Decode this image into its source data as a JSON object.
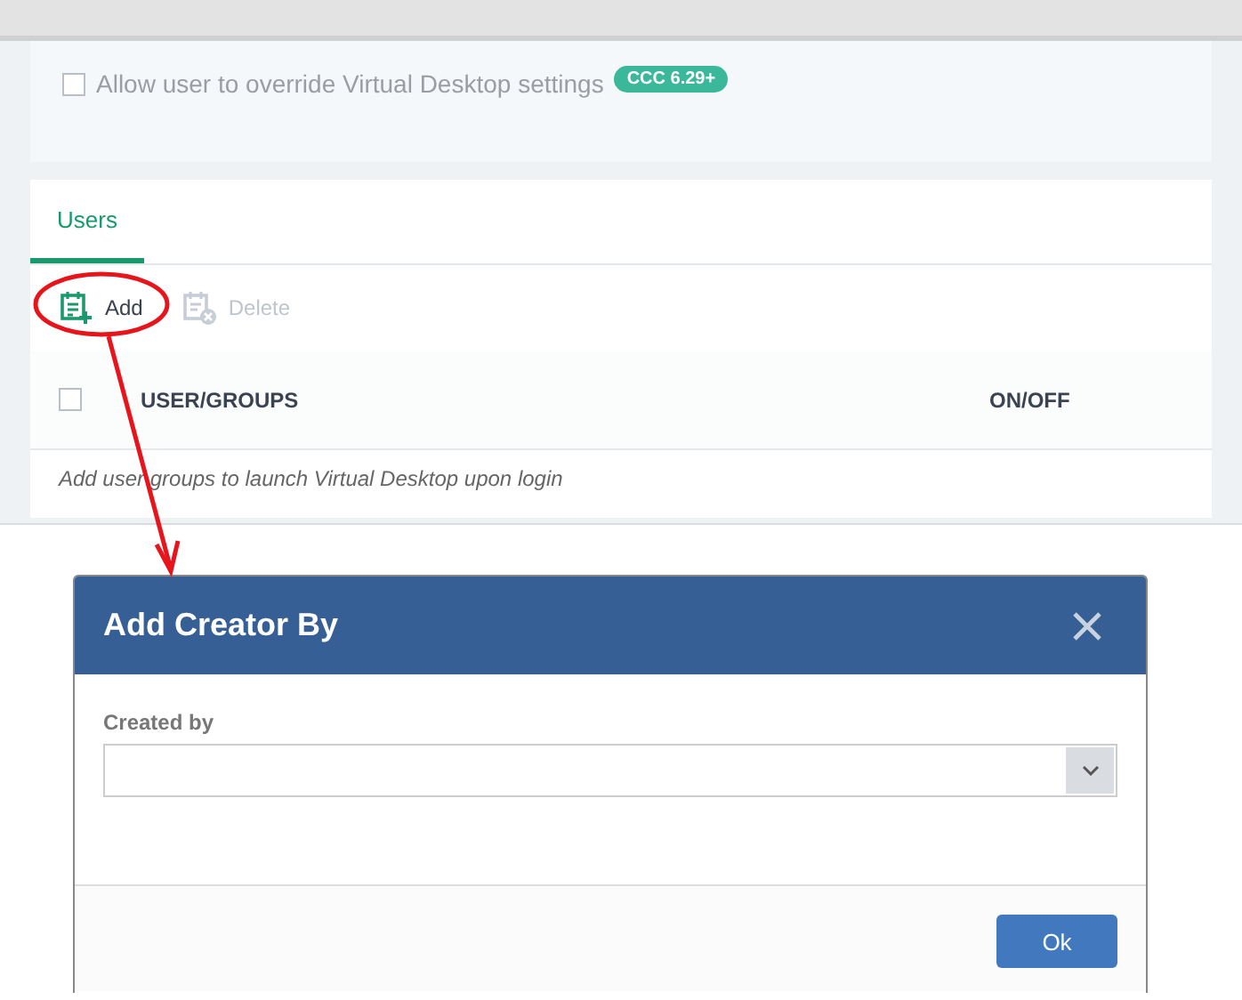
{
  "settings": {
    "override_option": {
      "label": "Allow user to override Virtual Desktop settings",
      "checked": false,
      "badge": "CCC 6.29+"
    }
  },
  "tabs": [
    {
      "label": "Users",
      "selected": true
    }
  ],
  "toolbar": [
    {
      "kind": "add",
      "label": "Add",
      "disabled": false
    },
    {
      "kind": "delete",
      "label": "Delete",
      "disabled": true
    }
  ],
  "table": {
    "select_all": {
      "checked": false
    },
    "columns": [
      "USER/GROUPS",
      "ON/OFF"
    ],
    "empty_message": "Add user groups to launch Virtual Desktop upon login"
  },
  "dialog": {
    "title": "Add Creator By",
    "field": {
      "label": "Created by"
    },
    "buttons": [
      "Ok"
    ]
  }
}
